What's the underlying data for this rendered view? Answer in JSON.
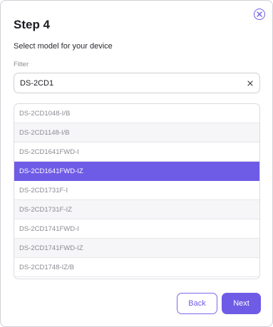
{
  "dialog": {
    "title": "Step 4",
    "subtitle": "Select model for your device",
    "close_icon": "close-circle-icon"
  },
  "filter": {
    "label": "Filter",
    "value": "DS-2CD1",
    "clear_icon": "clear-x-icon"
  },
  "model_list": {
    "items": [
      {
        "label": "DS-2CD1048-I/B"
      },
      {
        "label": "DS-2CD1148-I/B"
      },
      {
        "label": "DS-2CD1641FWD-I"
      },
      {
        "label": "DS-2CD1641FWD-IZ"
      },
      {
        "label": "DS-2CD1731F-I"
      },
      {
        "label": "DS-2CD1731F-IZ"
      },
      {
        "label": "DS-2CD1741FWD-I"
      },
      {
        "label": "DS-2CD1741FWD-IZ"
      },
      {
        "label": "DS-2CD1748-IZ/B"
      }
    ],
    "selected_index": 3
  },
  "footer": {
    "back_label": "Back",
    "next_label": "Next"
  },
  "colors": {
    "accent": "#6e5ce6",
    "border": "#cfcfd6",
    "text_muted": "#8a8a92"
  }
}
